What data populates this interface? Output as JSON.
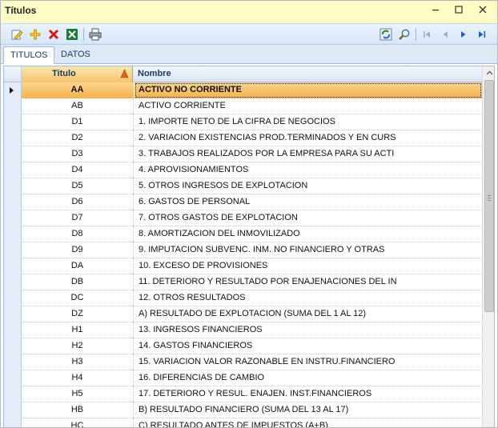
{
  "window": {
    "title": "Títulos"
  },
  "toolbar": {
    "icons": [
      "edit-icon",
      "add-icon",
      "delete-icon",
      "excel-icon",
      "print-icon",
      "refresh-icon",
      "search-icon",
      "first-record-icon",
      "previous-record-icon",
      "next-record-icon",
      "last-record-icon"
    ]
  },
  "tabs": [
    {
      "label": "TITULOS",
      "active": true
    },
    {
      "label": "DATOS",
      "active": false
    }
  ],
  "grid": {
    "columns": {
      "code": "Titulo",
      "name": "Nombre"
    },
    "rows": [
      {
        "code": "AA",
        "name": "ACTIVO NO CORRIENTE",
        "selected": true
      },
      {
        "code": "AB",
        "name": "ACTIVO CORRIENTE"
      },
      {
        "code": "D1",
        "name": "1. IMPORTE NETO DE LA CIFRA DE NEGOCIOS"
      },
      {
        "code": "D2",
        "name": "2. VARIACION EXISTENCIAS PROD.TERMINADOS Y EN CURS"
      },
      {
        "code": "D3",
        "name": "3. TRABAJOS REALIZADOS POR LA EMPRESA PARA SU ACTI"
      },
      {
        "code": "D4",
        "name": "4. APROVISIONAMIENTOS"
      },
      {
        "code": "D5",
        "name": "5. OTROS INGRESOS DE EXPLOTACION"
      },
      {
        "code": "D6",
        "name": "6. GASTOS DE PERSONAL"
      },
      {
        "code": "D7",
        "name": "7. OTROS GASTOS DE EXPLOTACION"
      },
      {
        "code": "D8",
        "name": "8. AMORTIZACION DEL INMOVILIZADO"
      },
      {
        "code": "D9",
        "name": "9. IMPUTACION SUBVENC. INM. NO FINANCIERO Y OTRAS"
      },
      {
        "code": "DA",
        "name": "10. EXCESO DE PROVISIONES"
      },
      {
        "code": "DB",
        "name": "11. DETERIORO Y RESULTADO POR ENAJENACIONES DEL IN"
      },
      {
        "code": "DC",
        "name": "12. OTROS RESULTADOS"
      },
      {
        "code": "DZ",
        "name": "A) RESULTADO DE EXPLOTACION (SUMA DEL 1 AL 12)"
      },
      {
        "code": "H1",
        "name": "13. INGRESOS FINANCIEROS"
      },
      {
        "code": "H2",
        "name": "14. GASTOS FINANCIEROS"
      },
      {
        "code": "H3",
        "name": "15. VARIACION VALOR RAZONABLE EN INSTRU.FINANCIERO"
      },
      {
        "code": "H4",
        "name": "16. DIFERENCIAS DE CAMBIO"
      },
      {
        "code": "H5",
        "name": "17. DETERIORO Y RESUL. ENAJEN. INST.FINANCIEROS"
      },
      {
        "code": "HB",
        "name": "B) RESULTADO FINANCIERO (SUMA DEL 13 AL 17)"
      },
      {
        "code": "HC",
        "name": "C) RESULTADO ANTES DE IMPUESTOS (A+B)"
      }
    ]
  },
  "colors": {
    "titlebar_bg": "#fffdc6",
    "selected_row": "#f5b04a",
    "accent_blue": "#1b3a66"
  }
}
